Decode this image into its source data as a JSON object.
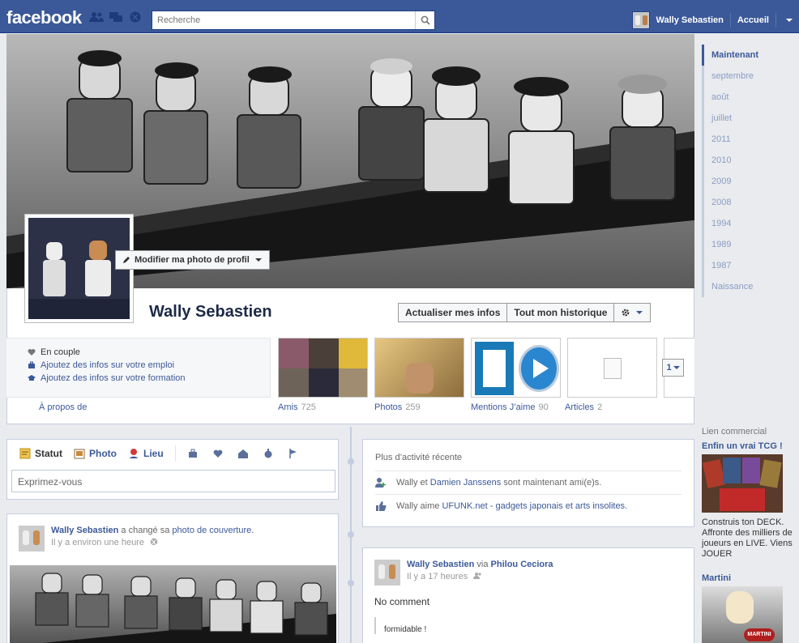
{
  "topbar": {
    "logo": "facebook",
    "search_placeholder": "Recherche",
    "user_name": "Wally Sebastien",
    "home": "Accueil"
  },
  "profile": {
    "edit_photo": "Modifier ma photo de profil",
    "name": "Wally Sebastien",
    "update_info": "Actualiser mes infos",
    "activity_log": "Tout mon historique"
  },
  "about": {
    "items": [
      {
        "label": "En couple",
        "icon": "heart-icon",
        "link": false
      },
      {
        "label": "Ajoutez des infos sur votre emploi",
        "icon": "briefcase-icon",
        "link": true
      },
      {
        "label": "Ajoutez des infos sur votre formation",
        "icon": "graduation-cap-icon",
        "link": true
      }
    ],
    "link_label": "À propos de"
  },
  "tiles": [
    {
      "label": "Amis",
      "count": "725"
    },
    {
      "label": "Photos",
      "count": "259"
    },
    {
      "label": "Mentions J’aime",
      "count": "90"
    },
    {
      "label": "Articles",
      "count": "2"
    }
  ],
  "tiles_more": "1",
  "scrubber": [
    "Maintenant",
    "septembre",
    "août",
    "juillet",
    "2011",
    "2010",
    "2009",
    "2008",
    "1994",
    "1989",
    "1987",
    "Naissance"
  ],
  "composer": {
    "tabs": [
      "Statut",
      "Photo",
      "Lieu"
    ],
    "placeholder": "Exprimez-vous"
  },
  "recent": {
    "header": "Plus d’activité récente",
    "line1_a": "Wally",
    "line1_b": "et",
    "line1_link": "Damien Janssens",
    "line1_c": "sont maintenant ami(e)s.",
    "line2_a": "Wally aime",
    "line2_link": "UFUNK.net - gadgets japonais et arts insolites."
  },
  "post1": {
    "name": "Wally Sebastien",
    "action": "a changé sa",
    "link": "photo de couverture.",
    "time": "Il y a environ une heure"
  },
  "post2": {
    "name": "Wally Sebastien",
    "via": "via",
    "via_name": "Philou Ceciora",
    "time": "Il y a 17 heures",
    "text": "No comment",
    "comment": "formidable !"
  },
  "ads": {
    "header": "Lien commercial",
    "ad1_title": "Enfin un vrai TCG !",
    "ad1_text": "Construis ton DECK. Affronte des milliers de joueurs en LIVE. Viens JOUER",
    "ad2_title": "Martini",
    "ad2_logo": "MARTINI"
  }
}
